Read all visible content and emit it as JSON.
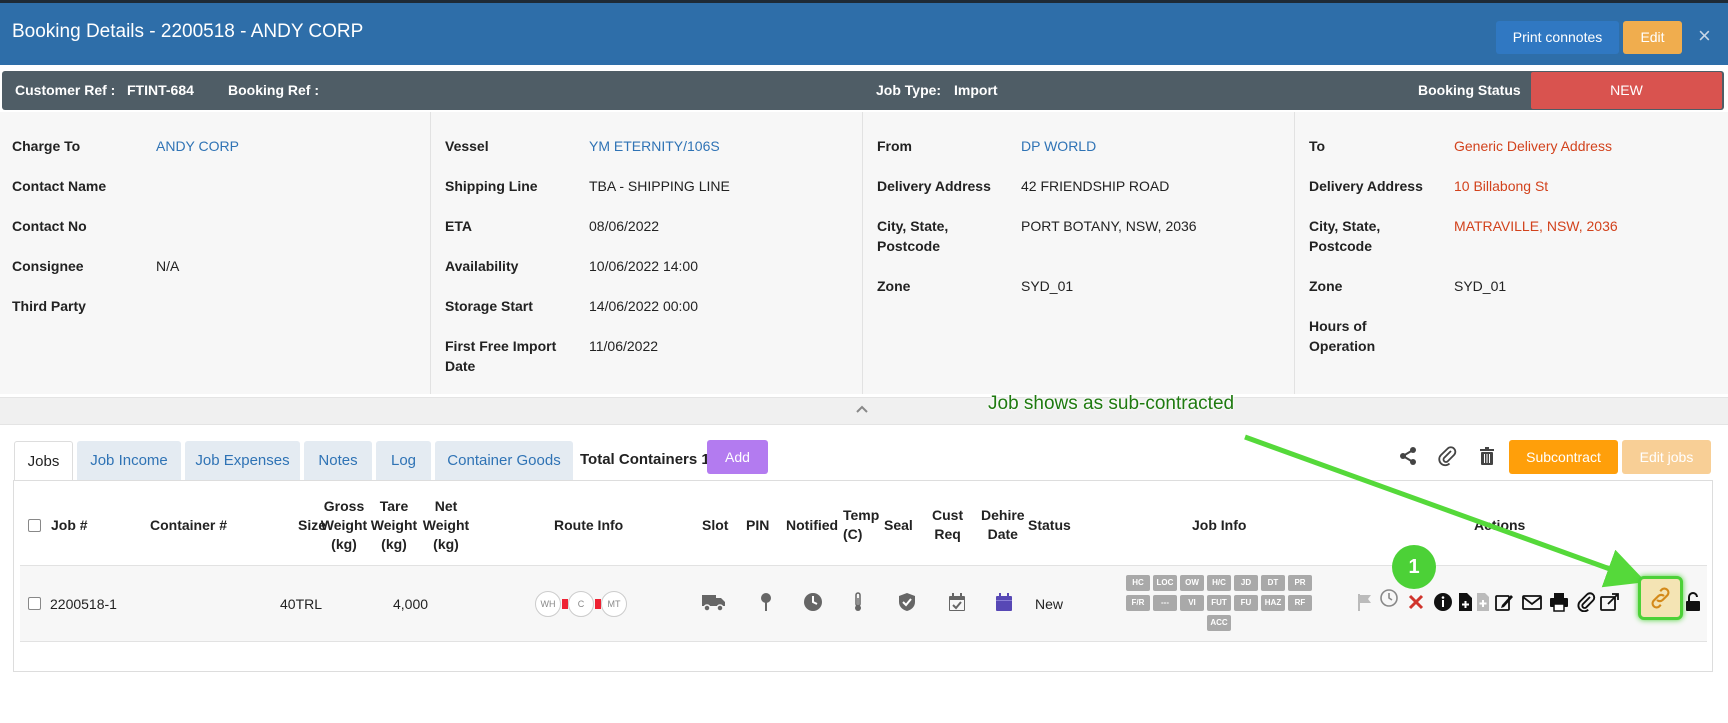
{
  "header": {
    "title": "Booking Details - 2200518 - ANDY CORP",
    "print_label": "Print connotes",
    "edit_label": "Edit",
    "close_glyph": "×"
  },
  "refbar": {
    "customer_ref_label": "Customer Ref :",
    "customer_ref_value": "FTINT-684",
    "booking_ref_label": "Booking Ref :",
    "job_type_label": "Job Type:",
    "job_type_value": "Import",
    "booking_status_label": "Booking Status",
    "booking_status_value": "NEW"
  },
  "charge_panel": {
    "charge_to_label": "Charge To",
    "charge_to_value": "ANDY CORP",
    "contact_name_label": "Contact Name",
    "contact_no_label": "Contact No",
    "consignee_label": "Consignee",
    "consignee_value": "N/A",
    "third_party_label": "Third Party"
  },
  "vessel_panel": {
    "vessel_label": "Vessel",
    "vessel_value": "YM ETERNITY/106S",
    "shipping_line_label": "Shipping Line",
    "shipping_line_value": "TBA - SHIPPING LINE",
    "eta_label": "ETA",
    "eta_value": "08/06/2022",
    "availability_label": "Availability",
    "availability_value": "10/06/2022 14:00",
    "storage_start_label": "Storage Start",
    "storage_start_value": "14/06/2022 00:00",
    "first_free_label_1": "First Free Import",
    "first_free_label_2": "Date",
    "first_free_value": "11/06/2022"
  },
  "from_panel": {
    "from_label": "From",
    "from_value": "DP WORLD",
    "delivery_label": "Delivery Address",
    "delivery_value": "42 FRIENDSHIP ROAD",
    "city_label_1": "City, State,",
    "city_label_2": "Postcode",
    "city_value": "PORT BOTANY, NSW, 2036",
    "zone_label": "Zone",
    "zone_value": "SYD_01"
  },
  "to_panel": {
    "to_label": "To",
    "to_value": "Generic Delivery Address",
    "delivery_label": "Delivery Address",
    "delivery_value": "10 Billabong St",
    "city_label_1": "City, State,",
    "city_label_2": "Postcode",
    "city_value": "MATRAVILLE, NSW, 2036",
    "zone_label": "Zone",
    "zone_value": "SYD_01",
    "hours_label_1": "Hours of",
    "hours_label_2": "Operation"
  },
  "annotation": {
    "label": "Job shows as sub-contracted",
    "step": "1"
  },
  "tabs": [
    "Jobs",
    "Job Income",
    "Job Expenses",
    "Notes",
    "Log",
    "Container Goods"
  ],
  "toolbar": {
    "total_containers": "Total Containers 1",
    "add_label": "Add",
    "subcontract_label": "Subcontract",
    "edit_jobs_label": "Edit jobs"
  },
  "table": {
    "headers": {
      "job": "Job #",
      "container": "Container #",
      "size": "Size",
      "gross": [
        "Gross",
        "Weight",
        "(kg)"
      ],
      "tare": [
        "Tare",
        "Weight",
        "(kg)"
      ],
      "net": [
        "Net",
        "Weight",
        "(kg)"
      ],
      "route": "Route Info",
      "slot": "Slot",
      "pin": "PIN",
      "notified": "Notified",
      "temp": [
        "Temp",
        "(C)"
      ],
      "seal": "Seal",
      "cust": [
        "Cust",
        "Req"
      ],
      "dehire": [
        "Dehire",
        "Date"
      ],
      "status": "Status",
      "job_info": "Job Info",
      "actions": "Actions"
    },
    "row": {
      "job": "2200518-1",
      "size": "40TRL",
      "tare": "4,000",
      "route": [
        "WH",
        "C",
        "MT"
      ],
      "status": "New"
    },
    "job_info_chips": [
      "HC",
      "LOC",
      "OW",
      "H/C",
      "JD",
      "DT",
      "PR",
      "F/R",
      "---",
      "VI",
      "FUT",
      "FU",
      "HAZ",
      "RF",
      "ACC"
    ]
  },
  "colors": {
    "header_blue": "#2e6ea9",
    "status_red": "#d9534f",
    "edit_orange": "#f0ad4e",
    "add_purple": "#b37bf0",
    "subcontract_orange": "#ff9f0a",
    "annotation_green": "#4cd137"
  }
}
